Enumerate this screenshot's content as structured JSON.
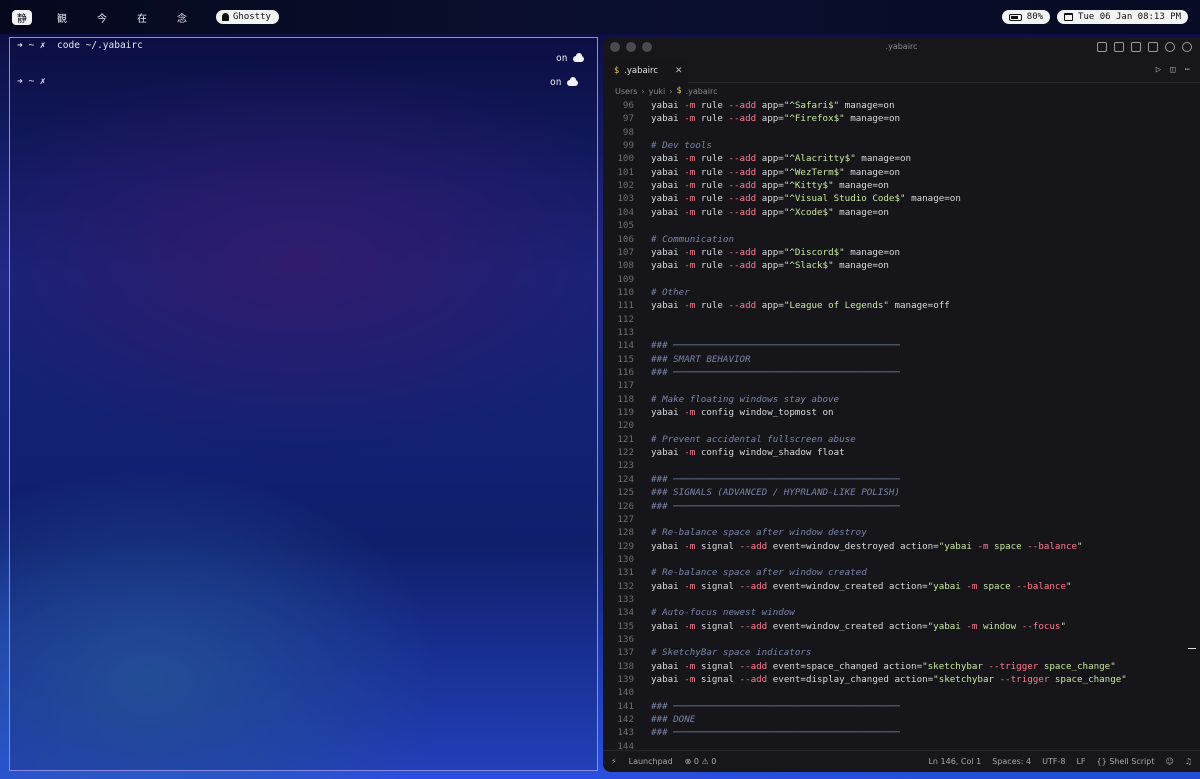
{
  "menubar": {
    "spaces": [
      "静",
      "観",
      "今",
      "在",
      "念"
    ],
    "active_app": "Ghostty",
    "battery": "80%",
    "datetime": "Tue 06 Jan 08:13 PM"
  },
  "terminal": {
    "line1_prompt": "➜ ~ ✗  code ~/.yabairc",
    "line1_status": "on",
    "line2_prompt": "➜ ~ ✗",
    "line2_status": "on"
  },
  "vscode": {
    "title": ".yabairc",
    "tab_label": ".yabairc",
    "tab_icon": "$",
    "breadcrumb": [
      "Users",
      "yuki",
      ".yabairc"
    ],
    "code_lines": [
      {
        "n": "96",
        "t": "yabai -m rule --add app=\"^Safari$\" manage=on"
      },
      {
        "n": "97",
        "t": "yabai -m rule --add app=\"^Firefox$\" manage=on"
      },
      {
        "n": "98",
        "t": ""
      },
      {
        "n": "99",
        "t": "# Dev tools"
      },
      {
        "n": "100",
        "t": "yabai -m rule --add app=\"^Alacritty$\" manage=on"
      },
      {
        "n": "101",
        "t": "yabai -m rule --add app=\"^WezTerm$\" manage=on"
      },
      {
        "n": "102",
        "t": "yabai -m rule --add app=\"^Kitty$\" manage=on"
      },
      {
        "n": "103",
        "t": "yabai -m rule --add app=\"^Visual Studio Code$\" manage=on"
      },
      {
        "n": "104",
        "t": "yabai -m rule --add app=\"^Xcode$\" manage=on"
      },
      {
        "n": "105",
        "t": ""
      },
      {
        "n": "106",
        "t": "# Communication"
      },
      {
        "n": "107",
        "t": "yabai -m rule --add app=\"^Discord$\" manage=on"
      },
      {
        "n": "108",
        "t": "yabai -m rule --add app=\"^Slack$\" manage=on"
      },
      {
        "n": "109",
        "t": ""
      },
      {
        "n": "110",
        "t": "# Other"
      },
      {
        "n": "111",
        "t": "yabai -m rule --add app=\"League of Legends\" manage=off"
      },
      {
        "n": "112",
        "t": ""
      },
      {
        "n": "113",
        "t": ""
      },
      {
        "n": "114",
        "t": "### ─────────────────────────────────────────"
      },
      {
        "n": "115",
        "t": "### SMART BEHAVIOR"
      },
      {
        "n": "116",
        "t": "### ─────────────────────────────────────────"
      },
      {
        "n": "117",
        "t": ""
      },
      {
        "n": "118",
        "t": "# Make floating windows stay above"
      },
      {
        "n": "119",
        "t": "yabai -m config window_topmost on"
      },
      {
        "n": "120",
        "t": ""
      },
      {
        "n": "121",
        "t": "# Prevent accidental fullscreen abuse"
      },
      {
        "n": "122",
        "t": "yabai -m config window_shadow float"
      },
      {
        "n": "123",
        "t": ""
      },
      {
        "n": "124",
        "t": "### ─────────────────────────────────────────"
      },
      {
        "n": "125",
        "t": "### SIGNALS (ADVANCED / HYPRLAND-LIKE POLISH)"
      },
      {
        "n": "126",
        "t": "### ─────────────────────────────────────────"
      },
      {
        "n": "127",
        "t": ""
      },
      {
        "n": "128",
        "t": "# Re-balance space after window destroy"
      },
      {
        "n": "129",
        "t": "yabai -m signal --add event=window_destroyed action=\"yabai -m space --balance\""
      },
      {
        "n": "130",
        "t": ""
      },
      {
        "n": "131",
        "t": "# Re-balance space after window created"
      },
      {
        "n": "132",
        "t": "yabai -m signal --add event=window_created action=\"yabai -m space --balance\""
      },
      {
        "n": "133",
        "t": ""
      },
      {
        "n": "134",
        "t": "# Auto-focus newest window"
      },
      {
        "n": "135",
        "t": "yabai -m signal --add event=window_created action=\"yabai -m window --focus\""
      },
      {
        "n": "136",
        "t": ""
      },
      {
        "n": "137",
        "t": "# SketchyBar space indicators"
      },
      {
        "n": "138",
        "t": "yabai -m signal --add event=space_changed action=\"sketchybar --trigger space_change\""
      },
      {
        "n": "139",
        "t": "yabai -m signal --add event=display_changed action=\"sketchybar --trigger space_change\""
      },
      {
        "n": "140",
        "t": ""
      },
      {
        "n": "141",
        "t": "### ─────────────────────────────────────────"
      },
      {
        "n": "142",
        "t": "### DONE"
      },
      {
        "n": "143",
        "t": "### ─────────────────────────────────────────"
      },
      {
        "n": "144",
        "t": ""
      }
    ],
    "status": {
      "remote": "⚡",
      "launchpad": "Launchpad",
      "problems": "⊗ 0 ⚠ 0",
      "position": "Ln 146, Col 1",
      "spaces": "Spaces: 4",
      "encoding": "UTF-8",
      "eol": "LF",
      "language": "{} Shell Script"
    }
  },
  "colors": {
    "accent_border": "#8a8ce8",
    "flag": "#ff7a90",
    "string": "#c8e6a0",
    "comment": "#7a86a8"
  }
}
